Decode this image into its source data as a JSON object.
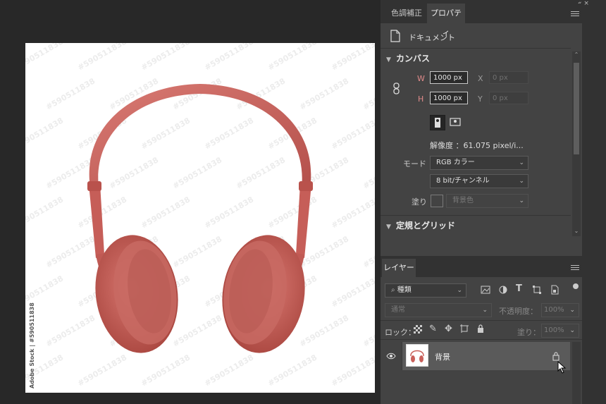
{
  "canvas": {
    "watermark_side": "Adobe Stock | #590511838",
    "watermark_tile": "#590511838"
  },
  "properties_panel": {
    "tabs": [
      "色調補正",
      "プロパティ"
    ],
    "active_tab": "プロパティ",
    "doc_label": "ドキュメント",
    "canvas_section": "カンバス",
    "w_label": "W",
    "w_value": "1000 px",
    "h_label": "H",
    "h_value": "1000 px",
    "x_label": "X",
    "x_placeholder": "0 px",
    "y_label": "Y",
    "y_placeholder": "0 px",
    "resolution": "解像度 ：61.075 pixel/i...",
    "mode_label": "モード",
    "mode_value": "RGB カラー",
    "bit_value": "8 bit/チャンネル",
    "fill_label": "塗り",
    "fill_value": "背景色",
    "rulers_section": "定規とグリッド"
  },
  "layers_panel": {
    "tab": "レイヤー",
    "filter_placeholder": "種類",
    "blend_mode": "通常",
    "opacity_label": "不透明度：",
    "opacity_value": "100%",
    "lock_label": "ロック：",
    "fill_label": "塗り：",
    "fill_value": "100%",
    "layers": [
      {
        "name": "背景",
        "visible": true,
        "locked": true,
        "selected": true
      }
    ]
  },
  "colors": {
    "headphone": "#c9605a",
    "panel_bg": "#434343",
    "dock_bg": "#323232",
    "workspace_bg": "#282828"
  }
}
